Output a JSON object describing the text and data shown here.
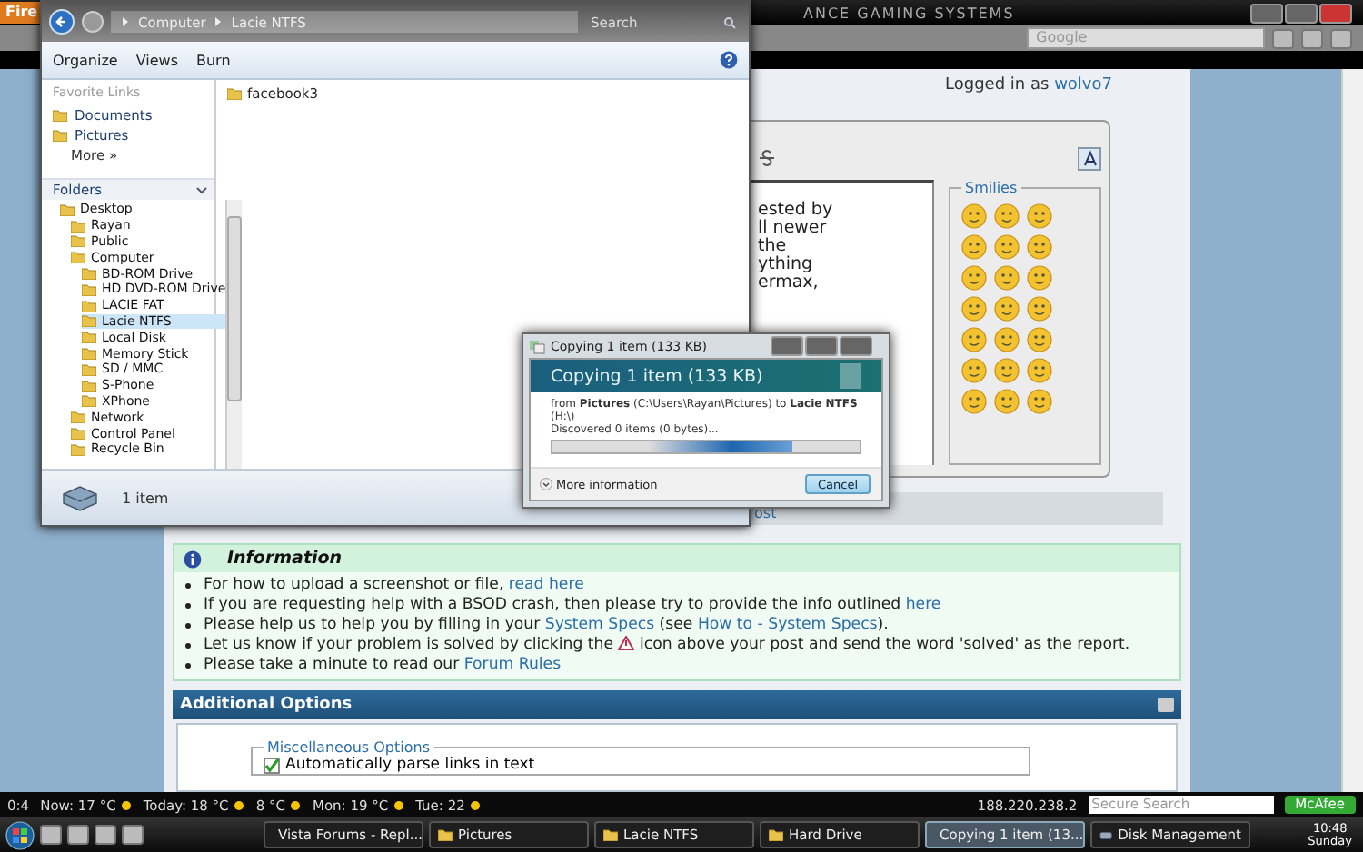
{
  "browser": {
    "menu_button": "Fire",
    "title": "ANCE GAMING SYSTEMS",
    "search_placeholder": "Google",
    "logged_in_label": "Logged in as",
    "user": "wolvo7"
  },
  "editor": {
    "text": "ested by\nll newer\nthe\nything\nermax,",
    "smilies_title": "Smilies",
    "post_fragment": "ost"
  },
  "information": {
    "title": "Information",
    "items": [
      [
        {
          "kind": "text",
          "text": "For how to upload a screenshot or file, "
        },
        {
          "kind": "link",
          "text": "read here"
        }
      ],
      [
        {
          "kind": "text",
          "text": "If you are requesting help with a BSOD crash, then please try to provide the info outlined "
        },
        {
          "kind": "link",
          "text": "here"
        }
      ],
      [
        {
          "kind": "text",
          "text": "Please help us to help you by filling in your "
        },
        {
          "kind": "link",
          "text": "System Specs"
        },
        {
          "kind": "text",
          "text": " (see "
        },
        {
          "kind": "link",
          "text": "How to - System Specs"
        },
        {
          "kind": "text",
          "text": ")."
        }
      ],
      [
        {
          "kind": "text",
          "text": "Let us know if your problem is solved by clicking the "
        },
        {
          "kind": "icon"
        },
        {
          "kind": "text",
          "text": " icon above your post and send the word 'solved' as the report."
        }
      ],
      [
        {
          "kind": "text",
          "text": "Please take a minute to read our "
        },
        {
          "kind": "link",
          "text": "Forum Rules"
        }
      ]
    ]
  },
  "additional_options": {
    "title": "Additional Options",
    "group_title": "Miscellaneous Options",
    "options": [
      {
        "label": "Automatically parse links in text",
        "checked": true
      }
    ]
  },
  "explorer": {
    "breadcrumb": [
      "Computer",
      "Lacie NTFS"
    ],
    "search_placeholder": "Search",
    "toolbar": [
      "Organize",
      "Views",
      "Burn"
    ],
    "favorite_links_title": "Favorite Links",
    "favorite_links": [
      "Documents",
      "Pictures"
    ],
    "more": "More »",
    "folders_title": "Folders",
    "tree": [
      {
        "label": "Desktop",
        "selected": false,
        "children": [
          {
            "label": "Rayan",
            "selected": false
          },
          {
            "label": "Public",
            "selected": false
          },
          {
            "label": "Computer",
            "selected": false,
            "children": [
              {
                "label": "BD-ROM Drive",
                "selected": false
              },
              {
                "label": "HD DVD-ROM Drive",
                "selected": false
              },
              {
                "label": "LACIE FAT",
                "selected": false
              },
              {
                "label": "Lacie NTFS",
                "selected": true
              },
              {
                "label": "Local Disk",
                "selected": false
              },
              {
                "label": "Memory Stick",
                "selected": false
              },
              {
                "label": "SD / MMC",
                "selected": false
              },
              {
                "label": "S-Phone",
                "selected": false
              },
              {
                "label": "XPhone",
                "selected": false
              }
            ]
          },
          {
            "label": "Network",
            "selected": false
          },
          {
            "label": "Control Panel",
            "selected": false
          },
          {
            "label": "Recycle Bin",
            "selected": false
          }
        ]
      }
    ],
    "files": [
      {
        "name": "facebook3"
      }
    ],
    "status": "1 item"
  },
  "copy_dialog": {
    "title": "Copying 1 item (133 KB)",
    "heading": "Copying 1 item (133 KB)",
    "from_line": "from **Pictures** (C:\\Users\\Rayan\\Pictures) to **Lacie NTFS** (H:\\)",
    "status": "Discovered 0 items (0 bytes)...",
    "progress": {
      "level": 0.78
    },
    "more_info": "More information",
    "cancel": "Cancel"
  },
  "status_bar": {
    "items": [
      {
        "kind": "counter",
        "label": "0:4"
      },
      {
        "kind": "weather",
        "label": "Now: 17 °C"
      },
      {
        "kind": "weather",
        "label": "Today: 18 °C"
      },
      {
        "kind": "weather",
        "label": "8 °C"
      },
      {
        "kind": "weather",
        "label": "Mon: 19 °C"
      },
      {
        "kind": "weather",
        "label": "Tue: 22"
      }
    ],
    "ip": "188.220.238.2",
    "search_placeholder": "Secure Search",
    "security": "McAfee"
  },
  "taskbar": {
    "tasks": [
      {
        "kind": "browser",
        "label": "Vista Forums - Repl...",
        "selected": false
      },
      {
        "kind": "folder",
        "label": "Pictures",
        "selected": false
      },
      {
        "kind": "folder",
        "label": "Lacie NTFS",
        "selected": false
      },
      {
        "kind": "folder",
        "label": "Hard Drive",
        "selected": false
      },
      {
        "kind": "copy",
        "label": "Copying 1 item (13...",
        "selected": true
      },
      {
        "kind": "disk",
        "label": "Disk Management",
        "selected": false
      }
    ],
    "time": "10:48",
    "day": "Sunday"
  }
}
